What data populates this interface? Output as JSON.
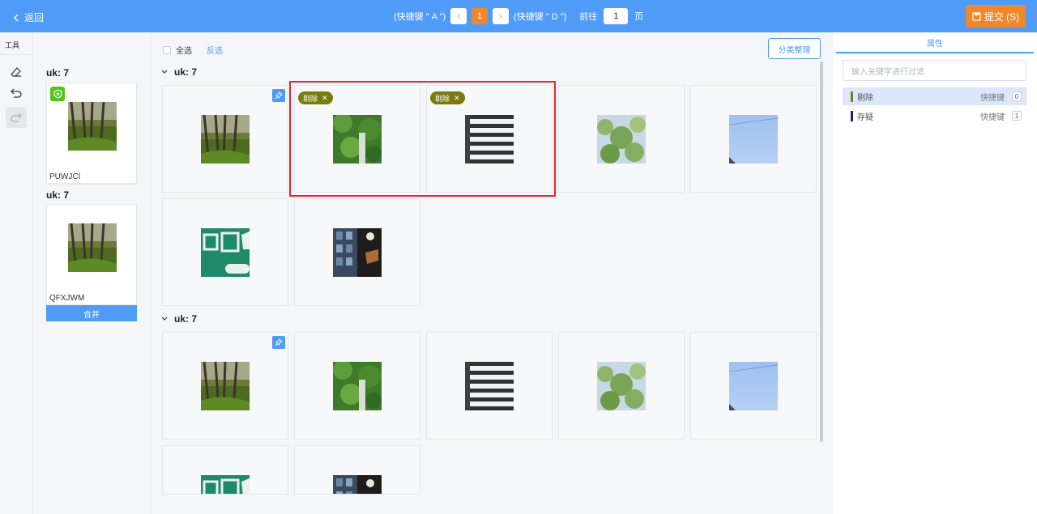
{
  "topbar": {
    "back_label": "返回",
    "prev_hint": "(快捷键 \" A \")",
    "current_page": "1",
    "next_hint": "(快捷键 \" D \")",
    "goto_label": "前往",
    "goto_value": "1",
    "page_unit": "页",
    "submit_label": "提交 (S)"
  },
  "tools": {
    "title": "工具"
  },
  "left_groups": [
    {
      "title": "uk: 7",
      "code": "PUWJCI"
    },
    {
      "title": "uk: 7",
      "code": "QFXJWM",
      "merge_label": "合并"
    }
  ],
  "main": {
    "select_all": "全选",
    "invert": "反选",
    "classify_button": "分类整理",
    "groups": [
      {
        "title": "uk: 7"
      },
      {
        "title": "uk: 7"
      }
    ],
    "tag_label": "剔除"
  },
  "right": {
    "tab": "属性",
    "search_placeholder": "输入关键字进行过滤",
    "attributes": [
      {
        "label": "剔除",
        "shortcut_label": "快捷键",
        "shortcut": "0",
        "color": "#7a7a0e"
      },
      {
        "label": "存疑",
        "shortcut_label": "快捷键",
        "shortcut": "1",
        "color": "#1a1a8c"
      }
    ]
  },
  "colors": {
    "accent": "#4e9bf8",
    "submit": "#f0882a",
    "highlight": "#e8262b",
    "tag": "#7a7a0e"
  }
}
